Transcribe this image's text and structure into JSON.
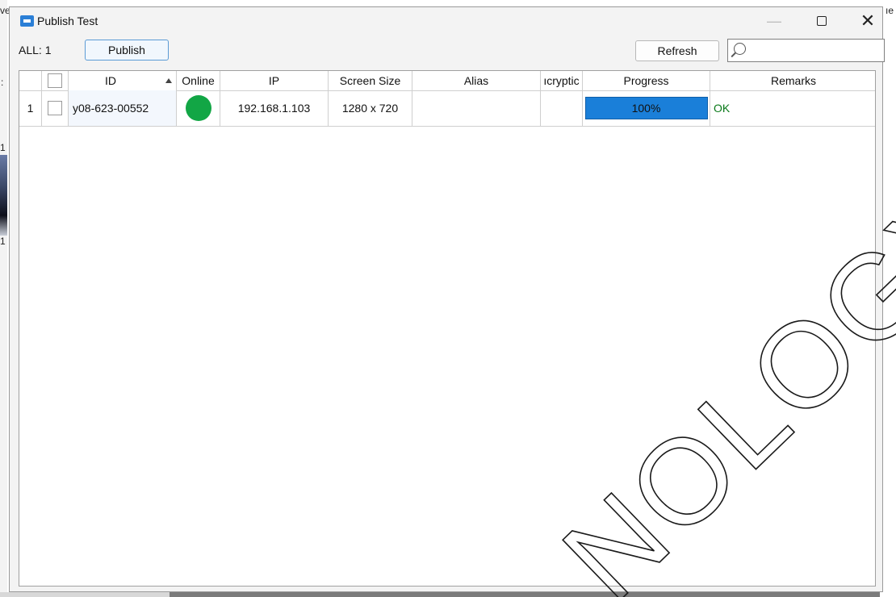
{
  "window": {
    "title": "Publish Test"
  },
  "toolbar": {
    "all_count": "ALL: 1",
    "publish_label": "Publish",
    "refresh_label": "Refresh",
    "search_placeholder": ""
  },
  "table": {
    "columns": [
      "",
      "ID",
      "Online",
      "IP",
      "Screen Size",
      "Alias",
      "ıcryptic",
      "Progress",
      "Remarks"
    ],
    "rows": [
      {
        "index": "1",
        "id": "y08-623-00552",
        "online": true,
        "ip": "192.168.1.103",
        "screen_size": "1280 x 720",
        "alias": "",
        "encryption": "",
        "progress": "100%",
        "progress_value": 100,
        "remarks": "OK"
      }
    ]
  },
  "background_fragments": {
    "left_top": "ve",
    "left_mid": ":",
    "left_a": "1",
    "left_b": "1",
    "right_top": "ıe"
  },
  "watermark": {
    "text": "NOLOGY CO"
  },
  "colors": {
    "online": "#12a645",
    "progress": "#1a7fd9",
    "ok_text": "#0a7a1a",
    "accent": "#2b7fd6"
  }
}
